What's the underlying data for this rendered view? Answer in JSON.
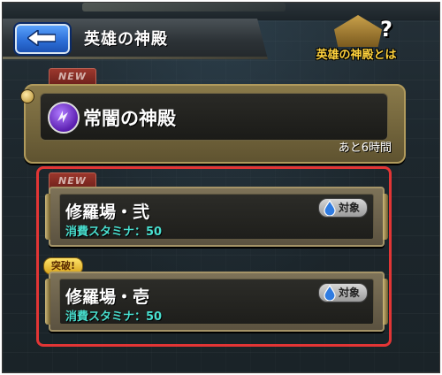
{
  "header": {
    "back_icon": "back-arrow-icon",
    "title": "英雄の神殿"
  },
  "help_badge": {
    "label": "英雄の神殿とは",
    "icon": "question-mark-icon"
  },
  "banner": {
    "tag": "NEW",
    "title": "常闇の神殿",
    "time_left": "あと6時間",
    "element_icon": "dark-element-icon",
    "colors": {
      "element": "#7b3fd6",
      "frame": "#8a7a4a"
    }
  },
  "stages": [
    {
      "tag": "NEW",
      "title": "修羅場・弐",
      "stamina": "消費スタミナ：50",
      "target_label": "対象",
      "target_icon": "water-drop-icon"
    },
    {
      "tag": "突破!",
      "title": "修羅場・壱",
      "stamina": "消費スタミナ：50",
      "target_label": "対象",
      "target_icon": "water-drop-icon"
    }
  ],
  "highlight_color": "#e23535"
}
